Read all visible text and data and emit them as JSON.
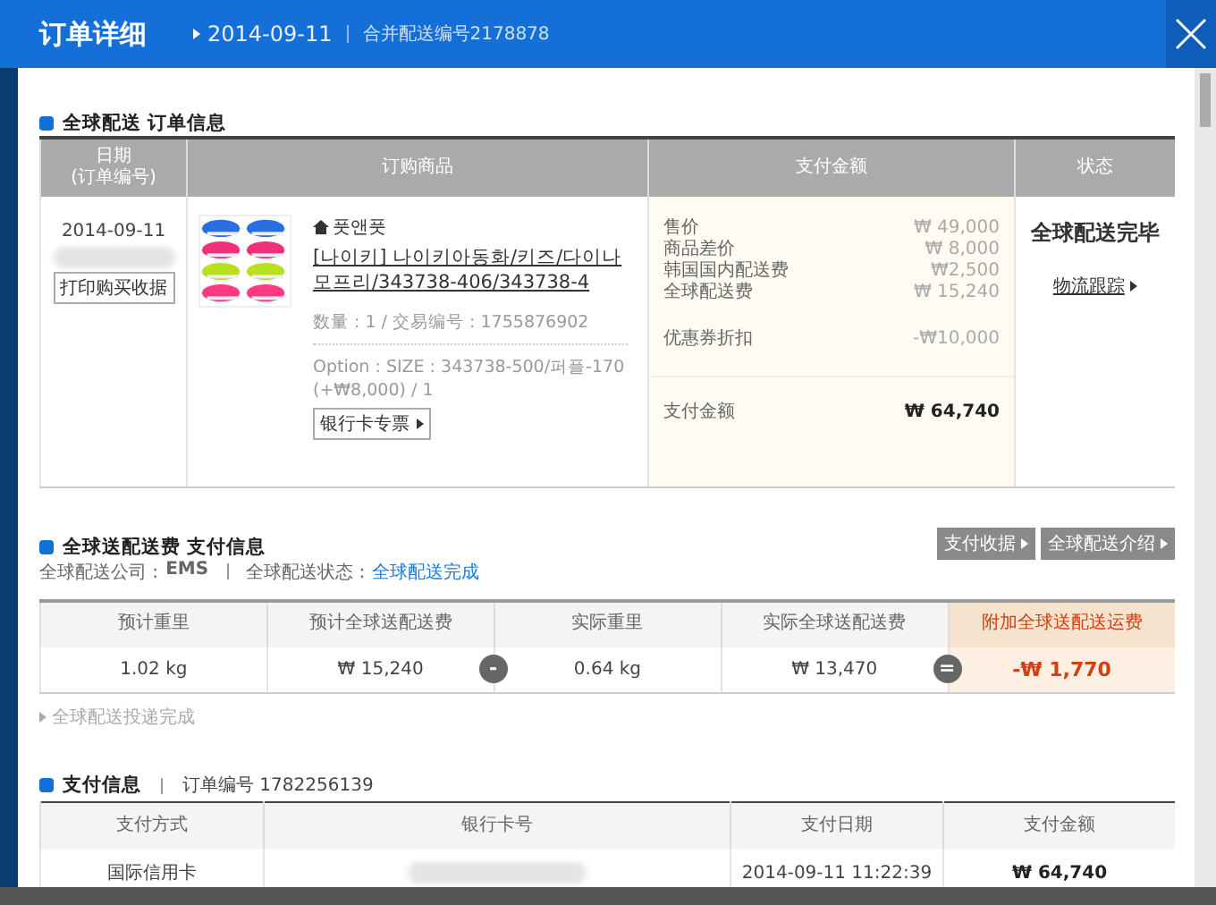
{
  "window": {
    "title": "订单详细",
    "date": "2014-09-11",
    "merge_no": "合并配送编号2178878"
  },
  "order_section": {
    "title": "全球配送 订单信息",
    "columns": [
      "日期\n(订单编号)",
      "订购商品",
      "支付金额",
      "状态"
    ],
    "date": "2014-09-11",
    "print_button": "打印购买收据",
    "seller": "풋앤풋",
    "product_link": "[나이키] 나이키아동화/키즈/다이나모프리/343738-406/343738-4",
    "quantity": "数量 : 1 / 交易编号 : 1755876902",
    "option": "Option : SIZE : 343738-500/퍼플-170 (+₩8,000) / 1",
    "invoice_button": "银行卡专票",
    "prices": [
      {
        "label": "售价",
        "value": "₩ 49,000"
      },
      {
        "label": "商品差价",
        "value": "₩ 8,000"
      },
      {
        "label": "韩国国内配送费",
        "value": "₩2,500"
      },
      {
        "label": "全球配送费",
        "value": "₩ 15,240"
      }
    ],
    "discount": {
      "label": "优惠券折扣",
      "value": "-₩10,000"
    },
    "total": {
      "label": "支付金额",
      "value": "₩ 64,740"
    },
    "status": "全球配送完毕",
    "tracking_link": "物流跟踪"
  },
  "shipping_section": {
    "title": "全球送配送费 支付信息",
    "company_label": "全球配送公司 : ",
    "company": "EMS",
    "state_label": "全球配送状态 : ",
    "state": "全球配送完成",
    "buttons": [
      "支付收据",
      "全球配送介绍"
    ],
    "columns": [
      "预计重里",
      "预计全球送配送费",
      "实际重里",
      "实际全球送配送费",
      "附加全球送配送运费"
    ],
    "row": [
      "1.02 kg",
      "₩ 15,240",
      "0.64 kg",
      "₩ 13,470",
      "-₩ 1,770"
    ],
    "operators": [
      "-",
      "="
    ],
    "note": "全球配送投递完成"
  },
  "payment_section": {
    "title": "支付信息",
    "order_no": "订单编号 1782256139",
    "columns": [
      "支付方式",
      "银行卡号",
      "支付日期",
      "支付金额"
    ],
    "row": [
      {
        "kind": "text",
        "text": "国际信用卡"
      },
      {
        "kind": "blurred"
      },
      {
        "kind": "text",
        "text": "2014-09-11 11:22:39"
      },
      {
        "kind": "amount",
        "text": "₩ 64,740"
      }
    ]
  }
}
